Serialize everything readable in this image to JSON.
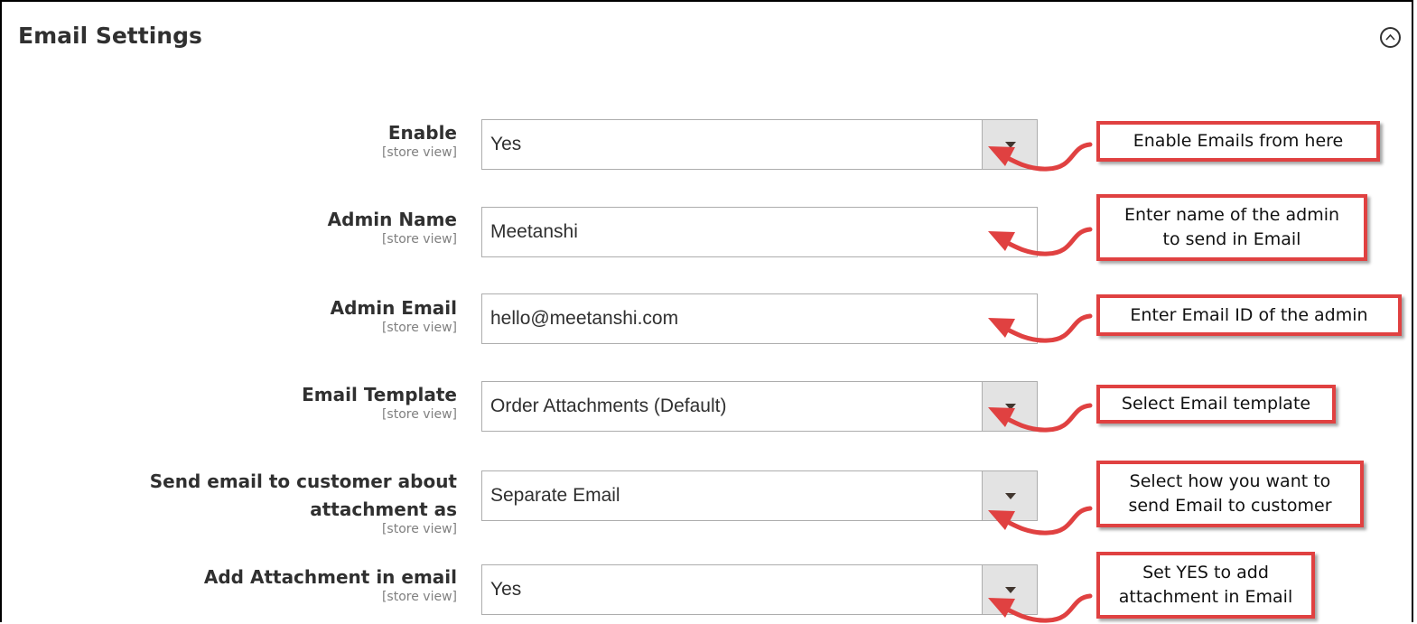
{
  "section": {
    "title": "Email Settings"
  },
  "fields": [
    {
      "label": "Enable",
      "scope": "[store view]",
      "value": "Yes",
      "type": "select"
    },
    {
      "label": "Admin Name",
      "scope": "[store view]",
      "value": "Meetanshi",
      "type": "text"
    },
    {
      "label": "Admin Email",
      "scope": "[store view]",
      "value": "hello@meetanshi.com",
      "type": "text"
    },
    {
      "label": "Email Template",
      "scope": "[store view]",
      "value": "Order Attachments (Default)",
      "type": "select"
    },
    {
      "label_line1": "Send email to customer about",
      "label_line2": "attachment as",
      "scope": "[store view]",
      "value": "Separate Email",
      "type": "select"
    },
    {
      "label": "Add Attachment in email",
      "scope": "[store view]",
      "value": "Yes",
      "type": "select"
    }
  ],
  "callouts": [
    "Enable Emails from here",
    "Enter name of the admin\nto send in Email",
    "Enter Email ID of the admin",
    "Select Email template",
    "Select how you want to\nsend Email to customer",
    "Set YES to add\nattachment in Email"
  ],
  "colors": {
    "callout_border": "#e04141",
    "arrow": "#e04141",
    "select_button": "#e3e3e3"
  },
  "icons": {
    "collapse": "chevron-up-circle-icon",
    "dropdown": "triangle-down-icon"
  }
}
